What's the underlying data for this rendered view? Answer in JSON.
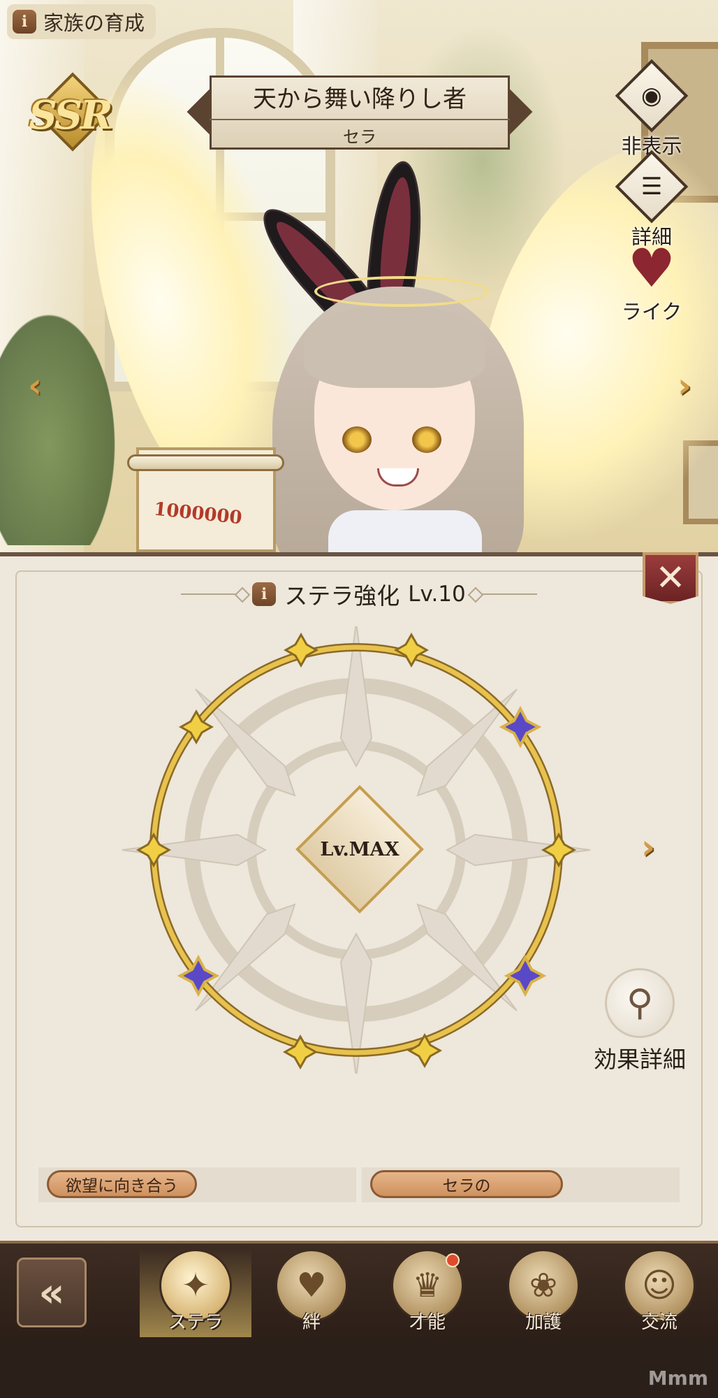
{
  "header": {
    "info_icon": "i",
    "title": "家族の育成"
  },
  "character": {
    "rarity": "SSR",
    "epithet": "天から舞い降りし者",
    "name": "セラ",
    "scroll_text": "1000000"
  },
  "side_buttons": {
    "hide_label": "非表示",
    "details_label": "詳細",
    "like_label": "ライク"
  },
  "panel": {
    "info_icon": "i",
    "title": "ステラ強化",
    "level": "Lv.10",
    "center_level": "Lv.MAX",
    "effect_details_label": "効果詳細",
    "slots": [
      {
        "label": "欲望に向き合う"
      },
      {
        "label": "セラの"
      }
    ]
  },
  "bottom_nav": {
    "tabs": [
      {
        "label": "ステラ",
        "active": true
      },
      {
        "label": "絆",
        "active": false
      },
      {
        "label": "才能",
        "active": false,
        "notify": true
      },
      {
        "label": "加護",
        "active": false
      },
      {
        "label": "交流",
        "active": false
      }
    ]
  },
  "icons": {
    "hide": "eye-icon",
    "details": "list-icon",
    "like": "heart-icon",
    "close": "close-icon",
    "back": "back-icon",
    "effect": "magnifier-icon",
    "prev": "chevron-left-icon",
    "next": "chevron-right-icon"
  },
  "colors": {
    "panel_bg": "#ede7dc",
    "ring_gold": "#d8b03c",
    "close_red": "#7f2b2b",
    "nav_bg": "#3d2c22",
    "slot_pill": "#d9a071"
  },
  "watermark": "Mmm"
}
